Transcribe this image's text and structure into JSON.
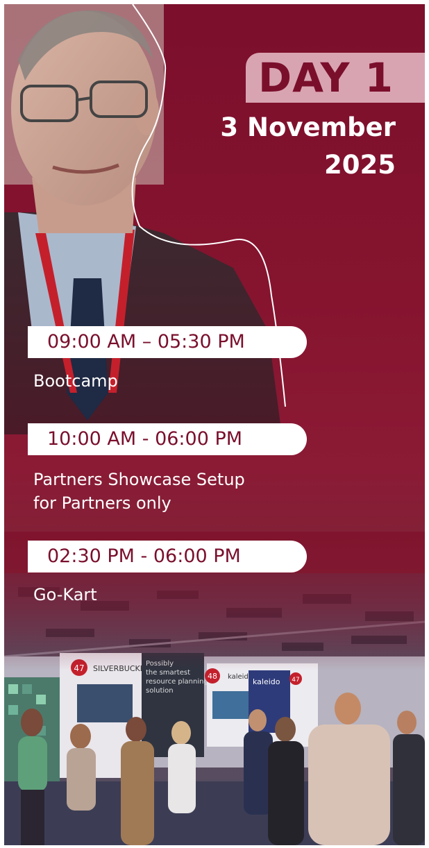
{
  "header": {
    "day_label": "DAY 1",
    "date_line1": "3 November",
    "date_line2": "2025"
  },
  "schedule": [
    {
      "time": "09:00 AM – 05:30 PM",
      "title_lines": [
        "Bootcamp"
      ]
    },
    {
      "time": "10:00 AM - 06:00 PM",
      "title_lines": [
        "Partners Showcase Setup",
        "for Partners only"
      ]
    },
    {
      "time": "02:30 PM - 06:00 PM",
      "title_lines": [
        "Go-Kart"
      ]
    }
  ],
  "booths": [
    {
      "number": "47",
      "brand": "SILVERBUCKET",
      "tagline": [
        "Possibly",
        "the smartest",
        "resource planning",
        "solution"
      ]
    },
    {
      "number": "48",
      "brand": "kaleido"
    },
    {
      "number": "47",
      "brand": "kaleido"
    }
  ],
  "colors": {
    "brand": "#7a0f2c",
    "accent_box": "#d9a4b1",
    "text_light": "#ffffff"
  }
}
